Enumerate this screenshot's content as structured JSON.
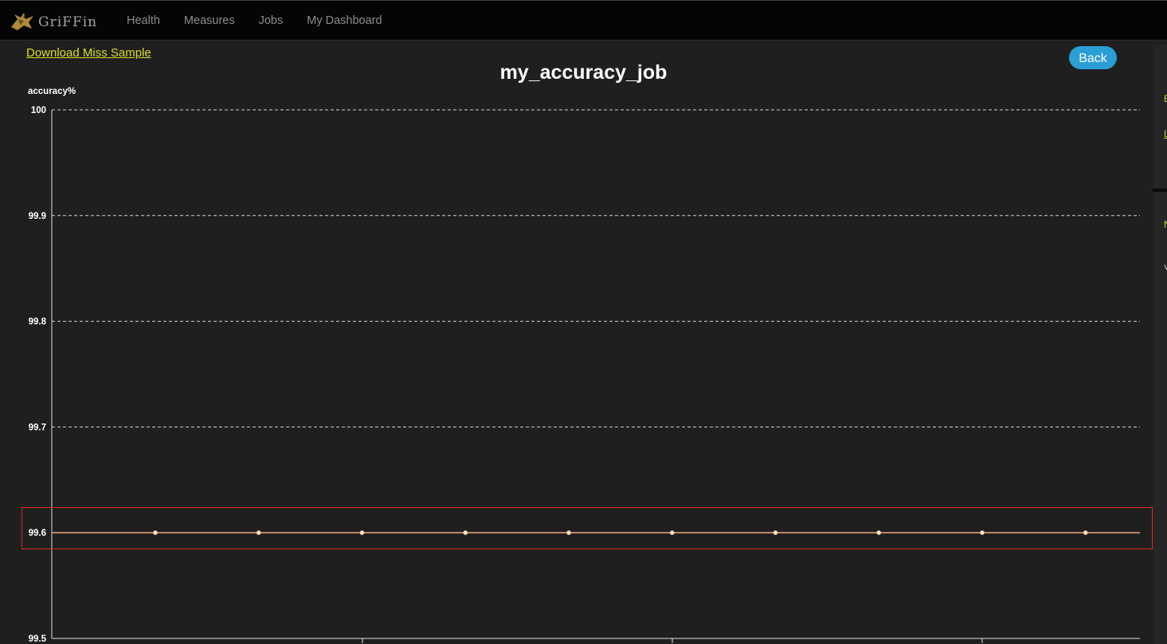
{
  "navbar": {
    "brand": "GriFFin",
    "links": [
      "Health",
      "Measures",
      "Jobs",
      "My Dashboard"
    ]
  },
  "page": {
    "download_label": "Download Miss Sample",
    "back_label": "Back",
    "title": "my_accuracy_job"
  },
  "right_panel": {
    "marks": [
      "E",
      "L",
      "N",
      "˅"
    ]
  },
  "colors": {
    "accent_link": "#d6df23",
    "back_button": "#2a9fd6",
    "series_line": "#f4a582",
    "highlight": "#e1251d"
  },
  "chart_data": {
    "type": "line",
    "title": "my_accuracy_job",
    "ylabel": "accuracy%",
    "xlabel": "",
    "ylim": [
      99.5,
      100
    ],
    "yticks": [
      100,
      99.9,
      99.8,
      99.7,
      99.6,
      99.5
    ],
    "grid": true,
    "series": [
      {
        "values": [
          99.6,
          99.6,
          99.6,
          99.6,
          99.6,
          99.6,
          99.6,
          99.6,
          99.6,
          99.6
        ]
      }
    ]
  }
}
